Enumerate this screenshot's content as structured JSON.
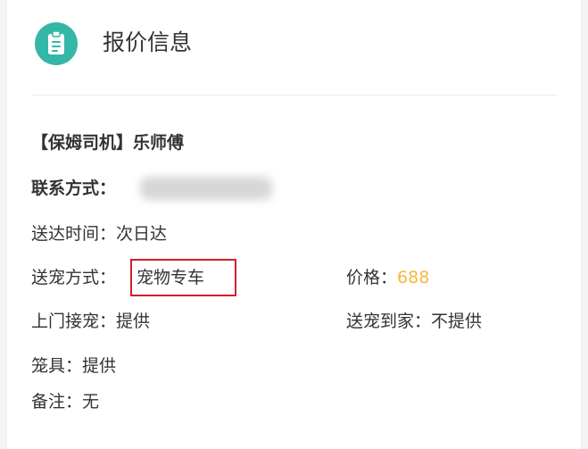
{
  "header": {
    "icon": "clipboard-icon",
    "title": "报价信息",
    "accent_color": "#34b7a7"
  },
  "quote": {
    "driver": "【保姆司机】乐师傅",
    "contact_label": "联系方式：",
    "delivery_time_label": "送达时间：",
    "delivery_time_value": "次日达",
    "delivery_method_label": "送宠方式：",
    "delivery_method_value": "宠物专车",
    "price_label": "价格：",
    "price_value": "688",
    "price_color": "#f5b83d",
    "pickup_label": "上门接宠：",
    "pickup_value": "提供",
    "home_delivery_label": "送宠到家：",
    "home_delivery_value": "不提供",
    "cage_label": "笼具：",
    "cage_value": "提供",
    "note_label": "备注：",
    "note_value": "无",
    "highlight_color": "#d21f2b"
  }
}
